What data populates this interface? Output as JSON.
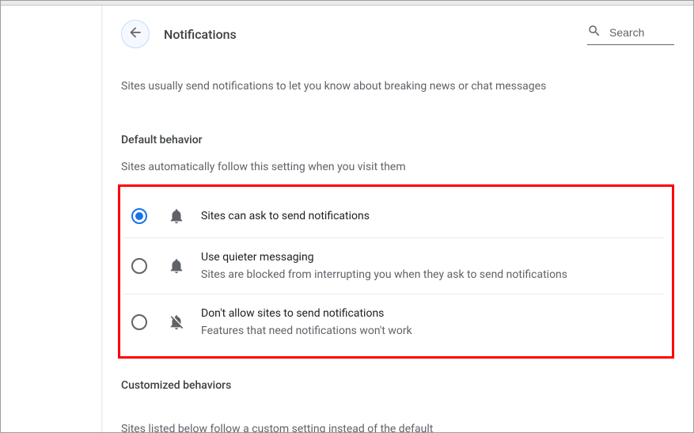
{
  "header": {
    "title": "Notifications",
    "search_placeholder": "Search"
  },
  "intro": "Sites usually send notifications to let you know about breaking news or chat messages",
  "default_behavior": {
    "heading": "Default behavior",
    "sub": "Sites automatically follow this setting when you visit them",
    "options": [
      {
        "label": "Sites can ask to send notifications",
        "desc": "",
        "selected": true
      },
      {
        "label": "Use quieter messaging",
        "desc": "Sites are blocked from interrupting you when they ask to send notifications",
        "selected": false
      },
      {
        "label": "Don't allow sites to send notifications",
        "desc": "Features that need notifications won't work",
        "selected": false
      }
    ]
  },
  "customized": {
    "heading": "Customized behaviors",
    "sub": "Sites listed below follow a custom setting instead of the default"
  }
}
